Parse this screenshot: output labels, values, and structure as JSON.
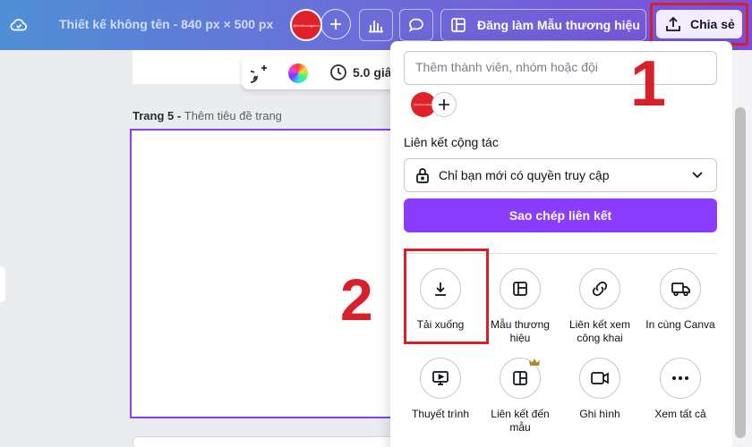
{
  "topbar": {
    "doc_title": "Thiết kế không tên - 840 px × 500 px",
    "avatar_text": "@tenthuonghieu",
    "brand_button_label": "Đăng làm Mẫu thương hiệu",
    "share_button_label": "Chia sẻ"
  },
  "canvas": {
    "page_label_bold": "Trang 5 - ",
    "page_label_title": "Thêm tiêu đề trang",
    "duration": "5.0 giâ"
  },
  "share_panel": {
    "people_placeholder": "Thêm thành viên, nhóm hoặc đội",
    "avatar_text": "@tenthuonghieu",
    "link_heading": "Liên kết cộng tác",
    "access_value": "Chỉ bạn mới có quyền truy cập",
    "copy_link_label": "Sao chép liên kết",
    "options_row1": [
      {
        "label": "Tải xuống",
        "icon": "download-icon"
      },
      {
        "label": "Mẫu thương hiệu",
        "icon": "template-icon"
      },
      {
        "label": "Liên kết xem công khai",
        "icon": "link-icon"
      },
      {
        "label": "In cùng Canva",
        "icon": "truck-icon"
      }
    ],
    "options_row2": [
      {
        "label": "Thuyết trình",
        "icon": "present-icon"
      },
      {
        "label": "Liên kết đến mẫu",
        "icon": "template-link-icon"
      },
      {
        "label": "Ghi hình",
        "icon": "video-icon"
      },
      {
        "label": "Xem tất cả",
        "icon": "more-icon"
      }
    ]
  },
  "annotations": {
    "step1": "1",
    "step2": "2"
  },
  "colors": {
    "accent": "#8b3dff",
    "annotation_red": "#d8202a",
    "avatar_red": "#e0202a"
  }
}
